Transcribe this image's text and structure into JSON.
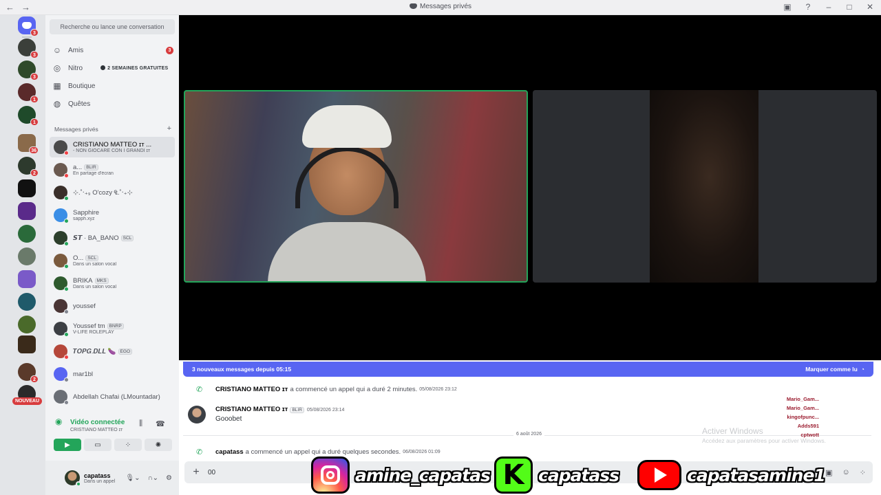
{
  "titlebar": {
    "title": "Messages privés"
  },
  "search": {
    "placeholder": "Recherche ou lance une conversation"
  },
  "nav": {
    "friends": {
      "label": "Amis",
      "badge": "3"
    },
    "nitro": {
      "label": "Nitro",
      "promo": "2 SEMAINES GRATUITES"
    },
    "shop": {
      "label": "Boutique"
    },
    "quests": {
      "label": "Quêtes"
    }
  },
  "dm_header": "Messages privés",
  "guild_badges": [
    "3",
    "3",
    "3",
    "1",
    "1",
    "36",
    "2",
    "2"
  ],
  "guild_new_label": "NOUVEAU",
  "dms": [
    {
      "name": "CRISTIANO MATTEO ɪᴛ ...",
      "sub": "- NON GIOCARE CON I GRANDI ɪᴛ",
      "color": "#4a4a4a",
      "status": "red",
      "active": true
    },
    {
      "name": "a...",
      "tag": "BLIR",
      "sub": "En partage d'écran",
      "color": "#6b5a50",
      "status": "red"
    },
    {
      "name": "⊹.˚‧₊₉ O'cozy ₠.˚‧₊⊹",
      "sub": "",
      "color": "#3a2f2a",
      "status": "online"
    },
    {
      "name": "Sapphire",
      "sub": "sapph.xyz",
      "color": "#3a8ee6",
      "status": "online"
    },
    {
      "name": "𝙎𝙏 · BA_BANO",
      "tag": "SCL",
      "sub": "",
      "color": "#2c3f2c",
      "status": "online"
    },
    {
      "name": "O...",
      "tag": "SCL",
      "sub": "Dans un salon vocal",
      "color": "#7a5a3d",
      "status": "online"
    },
    {
      "name": "BRIKA",
      "tag": "MKS",
      "sub": "Dans un salon vocal",
      "color": "#2e5a2e",
      "status": "online"
    },
    {
      "name": "youssef",
      "sub": "",
      "color": "#4a3535",
      "status": "idle"
    },
    {
      "name": "Youssef tm",
      "tag": "BNRP",
      "sub": "V-LIFE ROLEPLAY",
      "color": "#3c3f44",
      "status": "online"
    },
    {
      "name": "𝑻𝑶𝑷𝑮.𝑫𝑳𝑳 🍆",
      "tag": "EGO",
      "sub": "",
      "color": "#b5473a",
      "status": "red"
    },
    {
      "name": "mar1bl",
      "sub": "",
      "color": "#5865f2",
      "status": "idle"
    },
    {
      "name": "Abdellah Chafai (LMountadar)",
      "sub": "",
      "color": "#6a6e75",
      "status": "idle"
    }
  ],
  "voice": {
    "title": "Vidéo connectée",
    "sub": "CRISTIANO MATTEO ɪᴛ"
  },
  "user": {
    "name": "capatass",
    "status": "Dans un appel"
  },
  "chat": {
    "new_messages": "3 nouveaux messages depuis 05:15",
    "mark_read": "Marquer comme lu",
    "call1": {
      "author": "CRISTIANO MATTEO ɪᴛ",
      "text": "a commencé un appel qui a duré 2 minutes.",
      "time": "05/08/2026 23:12"
    },
    "message": {
      "author": "CRISTIANO MATTEO ɪᴛ",
      "tag": "BLIR",
      "time": "05/08/2026 23:14",
      "text": "Gooobet"
    },
    "date_divider": "6 août 2026",
    "call2": {
      "author": "capatass",
      "text": "a commencé un appel qui a duré quelques secondes.",
      "time": "06/08/2026 01:09"
    },
    "composer_value": "00"
  },
  "watermark": {
    "title": "Activer Windows",
    "sub": "Accédez aux paramètres pour activer Windows."
  },
  "activity": [
    {
      "name": "Mario_Gam...",
      "msg": ""
    },
    {
      "name": "Mario_Gam...",
      "msg": ""
    },
    {
      "name": "kingofpunc...",
      "msg": ""
    },
    {
      "name": "",
      "msg": ""
    },
    {
      "name": "Adds591",
      "msg": ""
    },
    {
      "name": "cptwott",
      "msg": ""
    }
  ],
  "overlay": {
    "instagram": "amine_capatas",
    "kick": "capatass",
    "kick_logo": "K",
    "youtube": "capatasamine1"
  }
}
